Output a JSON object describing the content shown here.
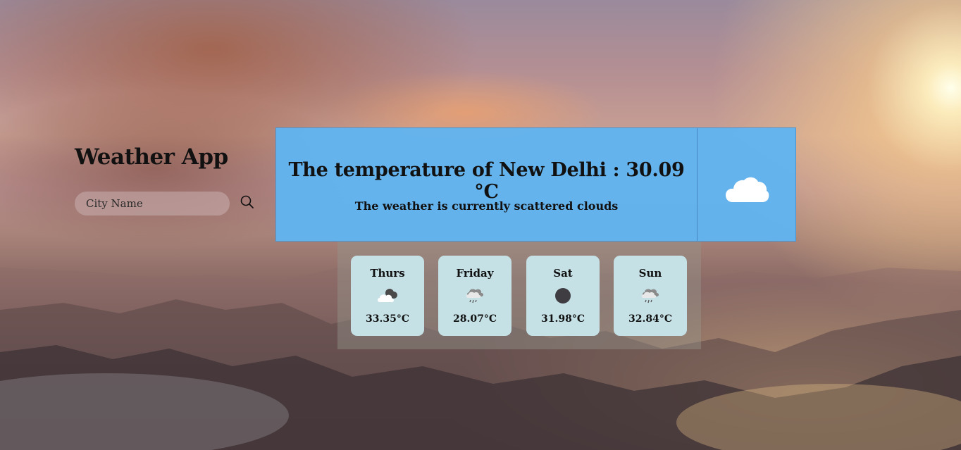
{
  "app": {
    "title": "Weather App"
  },
  "search": {
    "placeholder": "City Name",
    "value": "",
    "icon": "search-icon"
  },
  "current": {
    "heading": "The temperature of New Delhi : 30.09 °C",
    "description": "The weather is currently scattered clouds",
    "icon": "cloud-icon"
  },
  "forecast": [
    {
      "day": "Thurs",
      "temp": "33.35°C",
      "icon": "partly-cloudy-icon"
    },
    {
      "day": "Friday",
      "temp": "28.07°C",
      "icon": "rain-cloud-icon"
    },
    {
      "day": "Sat",
      "temp": "31.98°C",
      "icon": "dark-circle-icon"
    },
    {
      "day": "Sun",
      "temp": "32.84°C",
      "icon": "rain-cloud-icon"
    }
  ],
  "colors": {
    "main_card": "#61b4f0",
    "day_card": "#c5e1e6",
    "text": "#111111"
  }
}
